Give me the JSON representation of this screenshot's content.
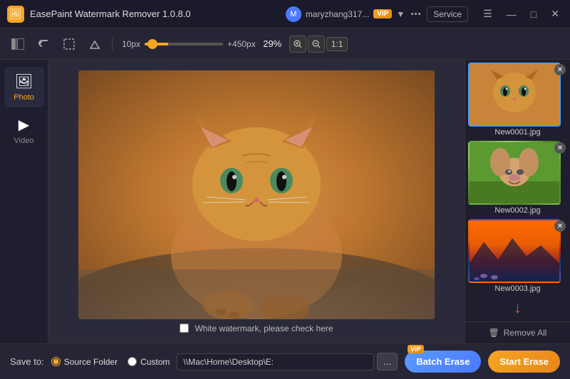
{
  "app": {
    "title": "EasePaint Watermark Remover  1.0.8.0",
    "icon": "🖼",
    "version": "1.0.8.0"
  },
  "titlebar": {
    "username": "maryzhang317...",
    "vip_label": "VIP",
    "service_label": "Service",
    "dots_icon": "···",
    "minimize": "—",
    "maximize": "□",
    "close": "✕"
  },
  "toolbar": {
    "zoom_min": "10px",
    "zoom_max": "+450px",
    "zoom_percent": "29%",
    "zoom_value": 29,
    "ratio_label": "1:1"
  },
  "nav": {
    "items": [
      {
        "id": "photo",
        "label": "Photo",
        "icon": "🖼",
        "active": true
      },
      {
        "id": "video",
        "label": "Video",
        "icon": "▶",
        "active": false
      }
    ]
  },
  "canvas": {
    "watermark_check_label": "White watermark, please check here"
  },
  "thumbnails": [
    {
      "id": 1,
      "label": "New0001.jpg",
      "type": "cat",
      "active": true
    },
    {
      "id": 2,
      "label": "New0002.jpg",
      "type": "dog",
      "active": false
    },
    {
      "id": 3,
      "label": "New0003.jpg",
      "type": "landscape",
      "active": false
    }
  ],
  "right_panel": {
    "remove_all_label": "Remove All",
    "add_icon": "+"
  },
  "bottom": {
    "save_to_label": "Save to:",
    "source_folder_label": "Source Folder",
    "custom_label": "Custom",
    "path_value": "\\\\Mac\\Home\\Desktop\\E:",
    "browse_icon": "...",
    "batch_erase_label": "Batch Erase",
    "start_erase_label": "Start Erase",
    "vip_label": "VIP"
  }
}
